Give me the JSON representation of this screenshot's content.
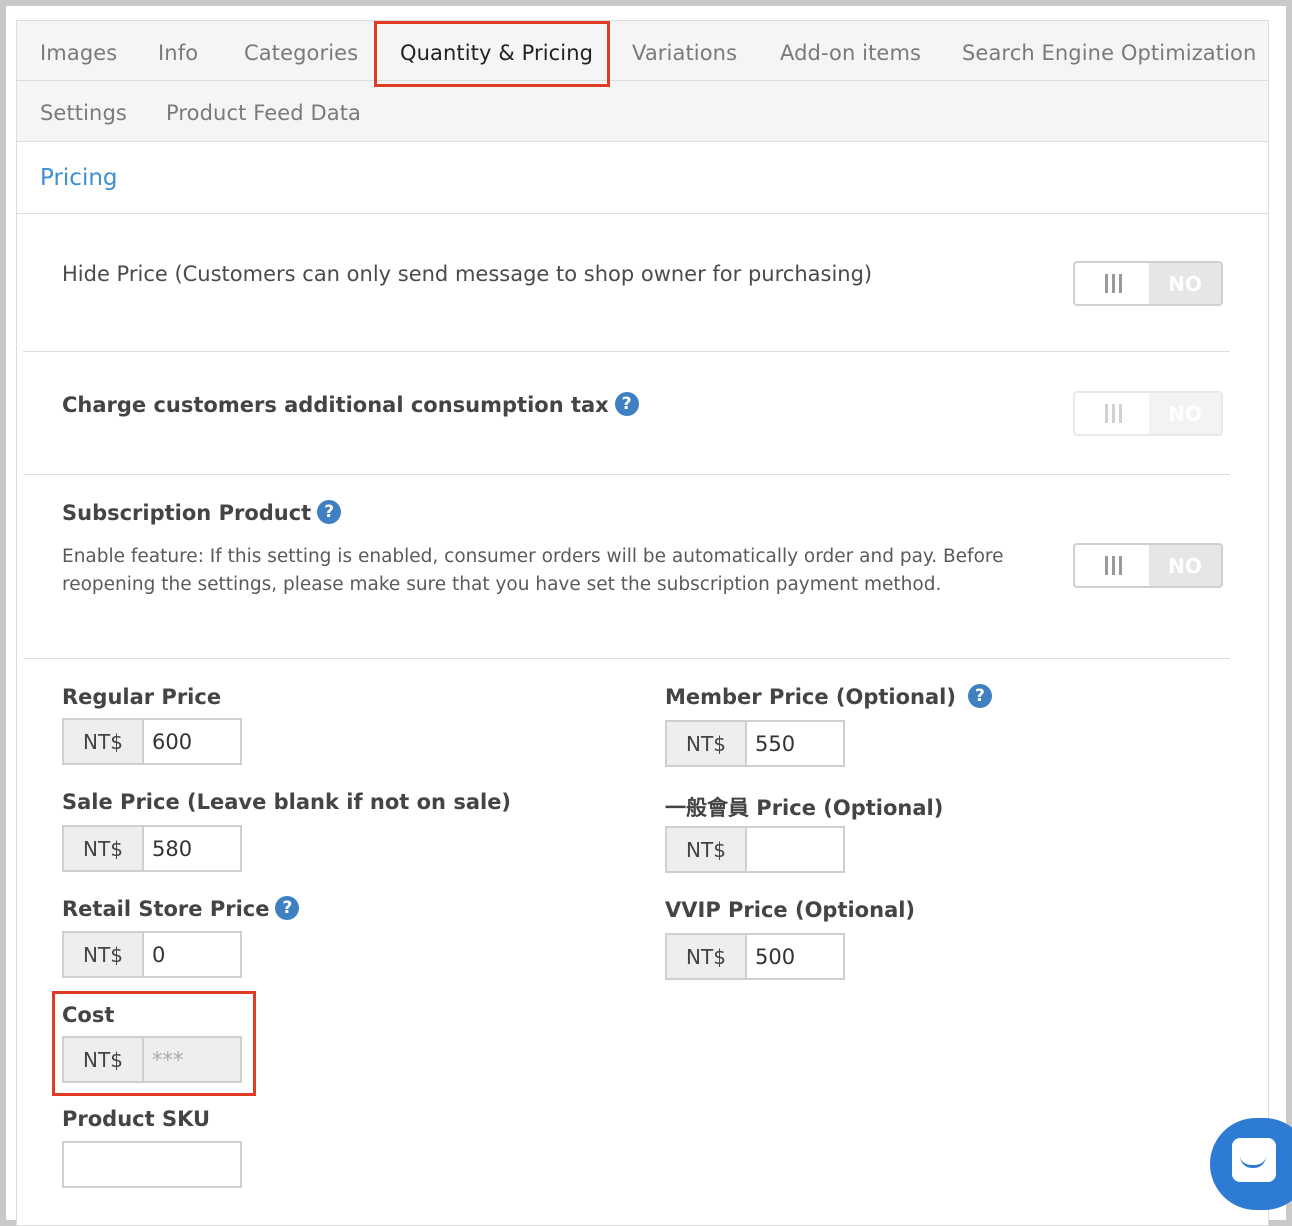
{
  "tabs": {
    "row1": [
      {
        "label": "Images"
      },
      {
        "label": "Info"
      },
      {
        "label": "Categories"
      },
      {
        "label": "Quantity & Pricing",
        "active": true
      },
      {
        "label": "Variations"
      },
      {
        "label": "Add-on items"
      },
      {
        "label": "Search Engine Optimization"
      }
    ],
    "row2": [
      {
        "label": "Settings"
      },
      {
        "label": "Product Feed Data"
      }
    ]
  },
  "section": {
    "title": "Pricing"
  },
  "options": {
    "hide_price": {
      "label": "Hide Price (Customers can only send message to shop owner for purchasing)",
      "state": "NO"
    },
    "consumption_tax": {
      "label": "Charge customers additional consumption tax",
      "state": "NO"
    },
    "subscription": {
      "label": "Subscription Product",
      "desc_line1": "Enable feature: If this setting is enabled, consumer orders will be automatically order and pay. Before",
      "desc_line2": "reopening the settings, please make sure that you have set the subscription payment method.",
      "state": "NO"
    }
  },
  "prices": {
    "currency": "NT$",
    "regular": {
      "label": "Regular Price",
      "value": "600"
    },
    "sale": {
      "label": "Sale Price (Leave blank if not on sale)",
      "value": "580"
    },
    "retail": {
      "label": "Retail Store Price",
      "value": "0"
    },
    "cost": {
      "label": "Cost",
      "value": "***"
    },
    "sku": {
      "label": "Product SKU",
      "value": ""
    },
    "member": {
      "label": "Member Price (Optional)",
      "value": "550"
    },
    "general_member": {
      "label": "一般會員 Price (Optional)",
      "value": ""
    },
    "vvip": {
      "label": "VVIP Price (Optional)",
      "value": "500"
    }
  },
  "help_glyph": "?",
  "colors": {
    "accent": "#3d8fd1",
    "highlight": "#e03c24",
    "help": "#3f80c2",
    "chat": "#2e7bd4"
  }
}
